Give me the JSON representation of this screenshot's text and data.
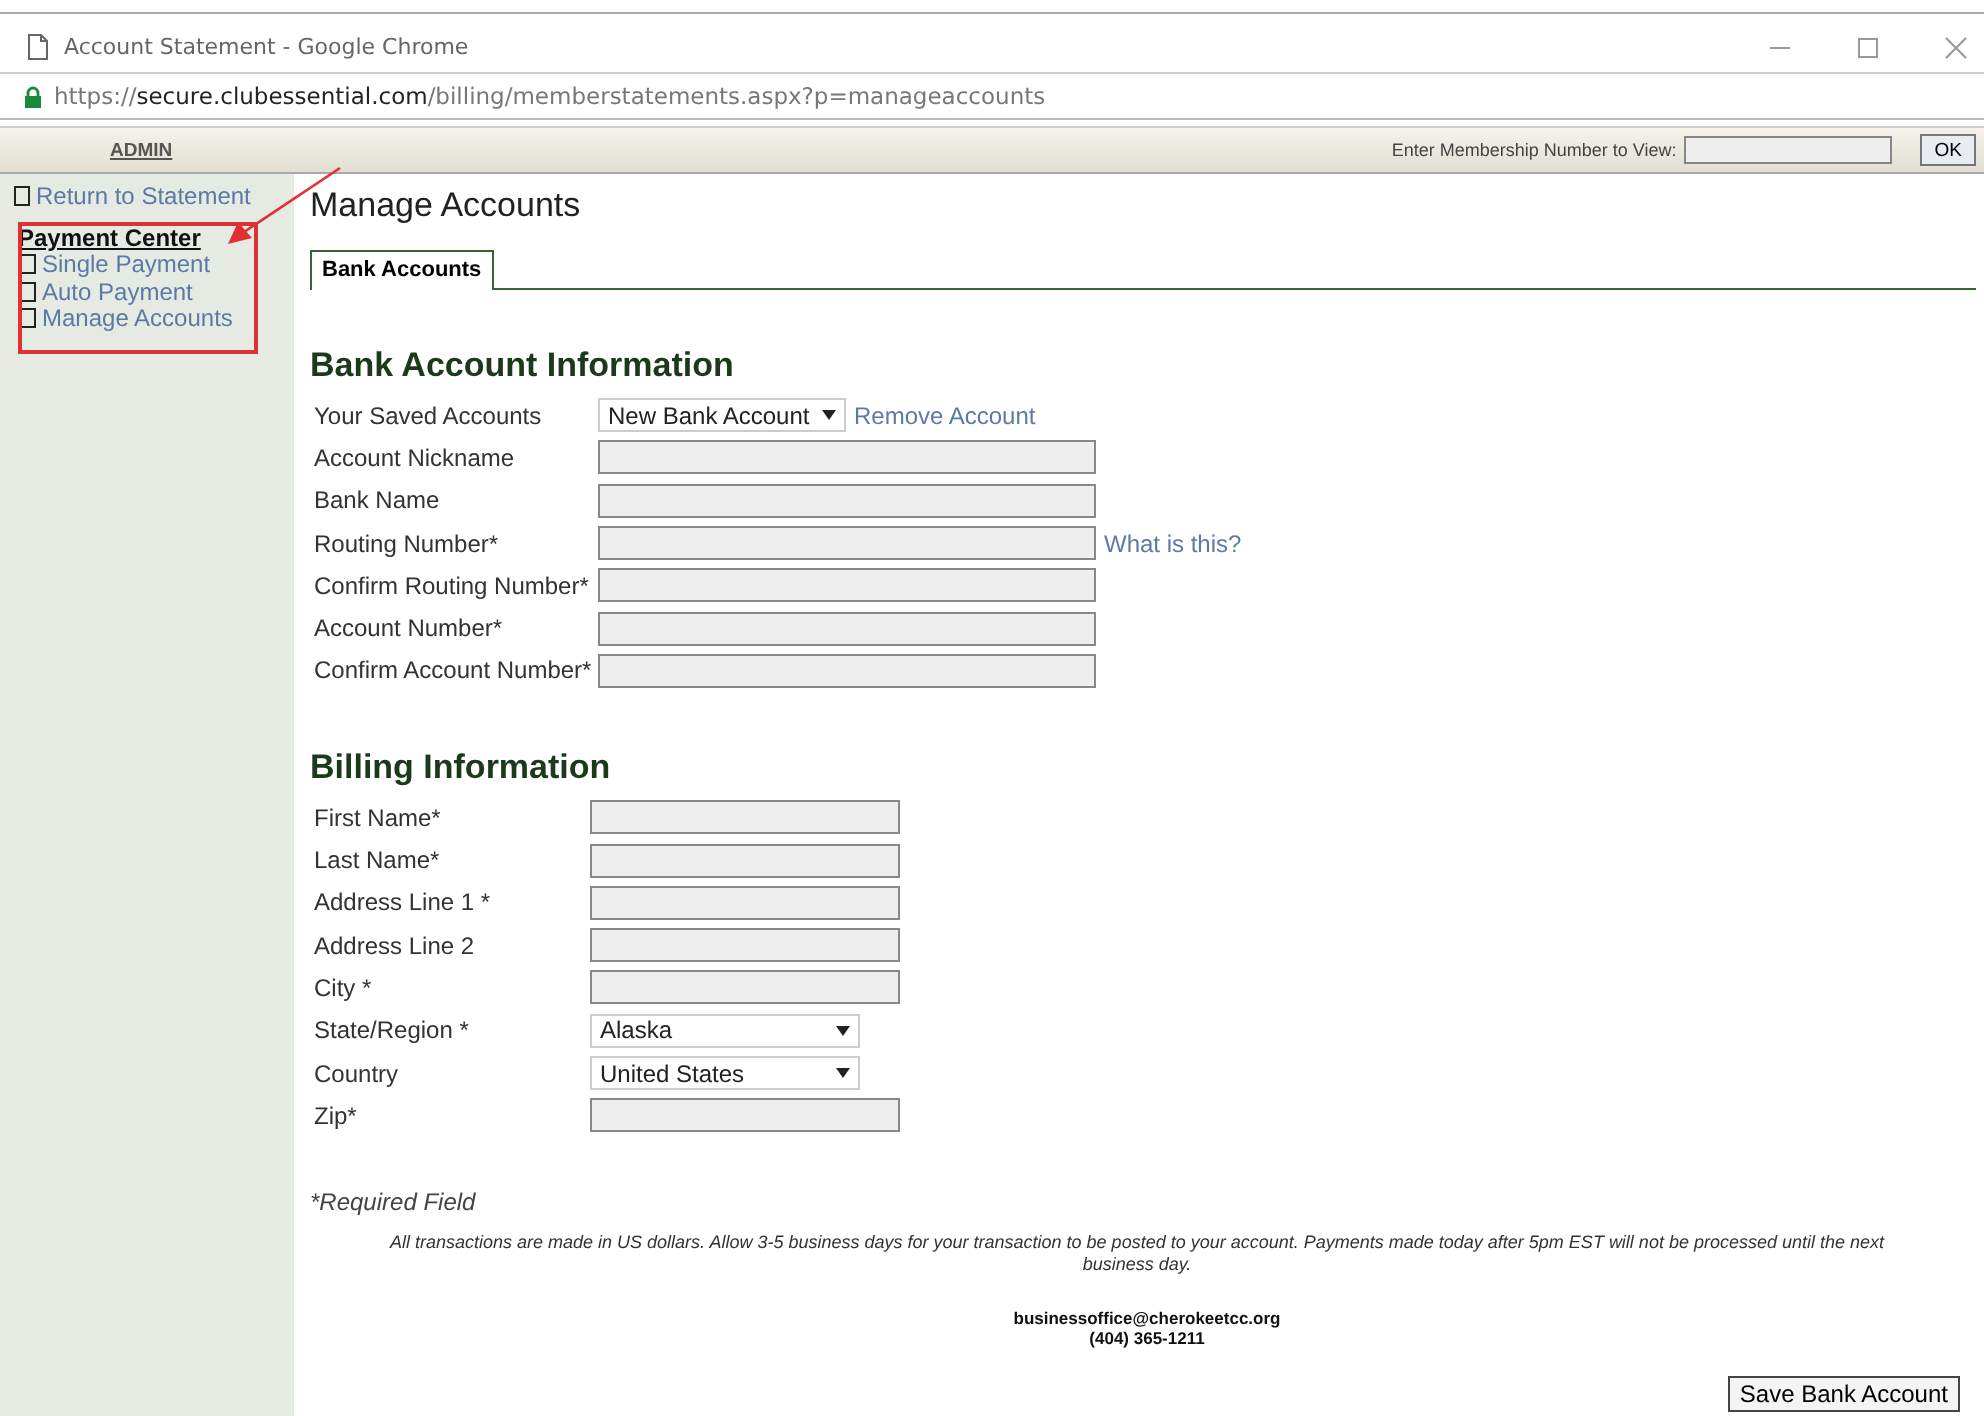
{
  "window": {
    "title": "Account Statement - Google Chrome",
    "url": "https://**secure.clubessential.com**/billing/memberstatements.aspx?p=manageaccounts"
  },
  "admin_bar": {
    "admin_link": "ADMIN",
    "membership_label": "Enter Membership Number to View:",
    "ok_button": "OK"
  },
  "sidebar": {
    "return_link": "Return to Statement",
    "section": "Payment Center",
    "items": [
      {
        "label": "Single Payment"
      },
      {
        "label": "Auto Payment"
      },
      {
        "label": "Manage Accounts"
      }
    ]
  },
  "page_title": "Manage Accounts",
  "tabs": [
    {
      "label": "Bank Accounts",
      "selected": true
    }
  ],
  "sections": [
    {
      "heading": "Bank Account Information",
      "fields": [
        {
          "label": "Your Saved Accounts",
          "kind": "select",
          "value": "New Bank Account",
          "link": "Remove Account"
        },
        {
          "label": "Account Nickname",
          "kind": "input"
        },
        {
          "label": "Bank Name",
          "kind": "input"
        },
        {
          "label": "Routing Number*",
          "kind": "input",
          "link": "What is this?"
        },
        {
          "label": "Confirm Routing Number*",
          "kind": "input"
        },
        {
          "label": "Account Number*",
          "kind": "input"
        },
        {
          "label": "Confirm Account Number*",
          "kind": "input"
        }
      ]
    },
    {
      "heading": "Billing Information",
      "fields": [
        {
          "label": "First Name*",
          "kind": "input"
        },
        {
          "label": "Last Name*",
          "kind": "input"
        },
        {
          "label": "Address Line 1 *",
          "kind": "input"
        },
        {
          "label": "Address Line 2",
          "kind": "input"
        },
        {
          "label": "City *",
          "kind": "input"
        },
        {
          "label": "State/Region *",
          "kind": "select",
          "value": "Alaska"
        },
        {
          "label": "Country",
          "kind": "select",
          "value": "United States"
        },
        {
          "label": "Zip*",
          "kind": "input"
        }
      ]
    }
  ],
  "required_note": "*Required Field",
  "disclaimer": "All transactions are made in US dollars. Allow 3-5 business days for your transaction to be posted to your account. Payments made today after 5pm EST will not be processed until the next business day.",
  "contact": {
    "email": "businessoffice@cherokeetcc.org",
    "phone": "(404) 365-1211"
  },
  "save_button": "Save Bank Account"
}
